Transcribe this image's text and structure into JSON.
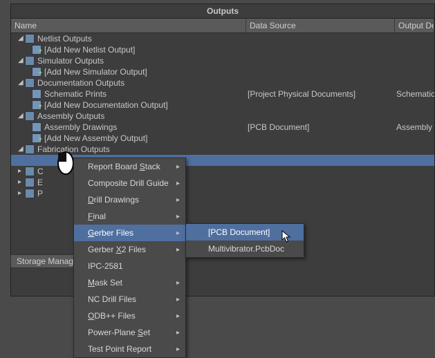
{
  "panel": {
    "title": "Outputs"
  },
  "columns": {
    "name": "Name",
    "data_source": "Data Source",
    "desc": "Output Descri"
  },
  "tree": {
    "netlist": {
      "label": "Netlist Outputs",
      "add": "[Add New Netlist Output]"
    },
    "simulator": {
      "label": "Simulator Outputs",
      "add": "[Add New Simulator Output]"
    },
    "doc": {
      "label": "Documentation Outputs",
      "add": "[Add New Documentation Output]",
      "item": {
        "name": "Schematic Prints",
        "ds": "[Project Physical Documents]",
        "desc": "Schematic Prin"
      }
    },
    "assembly": {
      "label": "Assembly Outputs",
      "add": "[Add New Assembly Output]",
      "item": {
        "name": "Assembly Drawings",
        "ds": "[PCB Document]",
        "desc": "Assembly Draw"
      }
    },
    "fab": {
      "label": "Fabrication Outputs"
    },
    "hidden": {
      "c": "C",
      "e": "E",
      "p": "P"
    }
  },
  "storage_btn": "Storage Manag",
  "ctx": {
    "items": [
      {
        "label": "Report Board Stack",
        "u": 13,
        "arrow": true
      },
      {
        "label": "Composite Drill Guide",
        "u": -1,
        "arrow": true
      },
      {
        "label": "Drill Drawings",
        "u": 0,
        "arrow": true
      },
      {
        "label": "Final",
        "u": 0,
        "arrow": true
      },
      {
        "label": "Gerber Files",
        "u": 0,
        "arrow": true,
        "sel": true
      },
      {
        "label": "Gerber X2 Files",
        "u": 7,
        "arrow": true
      },
      {
        "label": "IPC-2581",
        "u": -1,
        "arrow": false
      },
      {
        "label": "Mask Set",
        "u": 0,
        "arrow": true
      },
      {
        "label": "NC Drill Files",
        "u": -1,
        "arrow": true
      },
      {
        "label": "ODB++ Files",
        "u": 0,
        "arrow": true
      },
      {
        "label": "Power-Plane Set",
        "u": 12,
        "arrow": true
      },
      {
        "label": "Test Point Report",
        "u": -1,
        "arrow": true
      }
    ]
  },
  "sub": {
    "items": [
      {
        "label": "[PCB Document]",
        "sel": true
      },
      {
        "label": "Multivibrator.PcbDoc",
        "sel": false
      }
    ]
  }
}
